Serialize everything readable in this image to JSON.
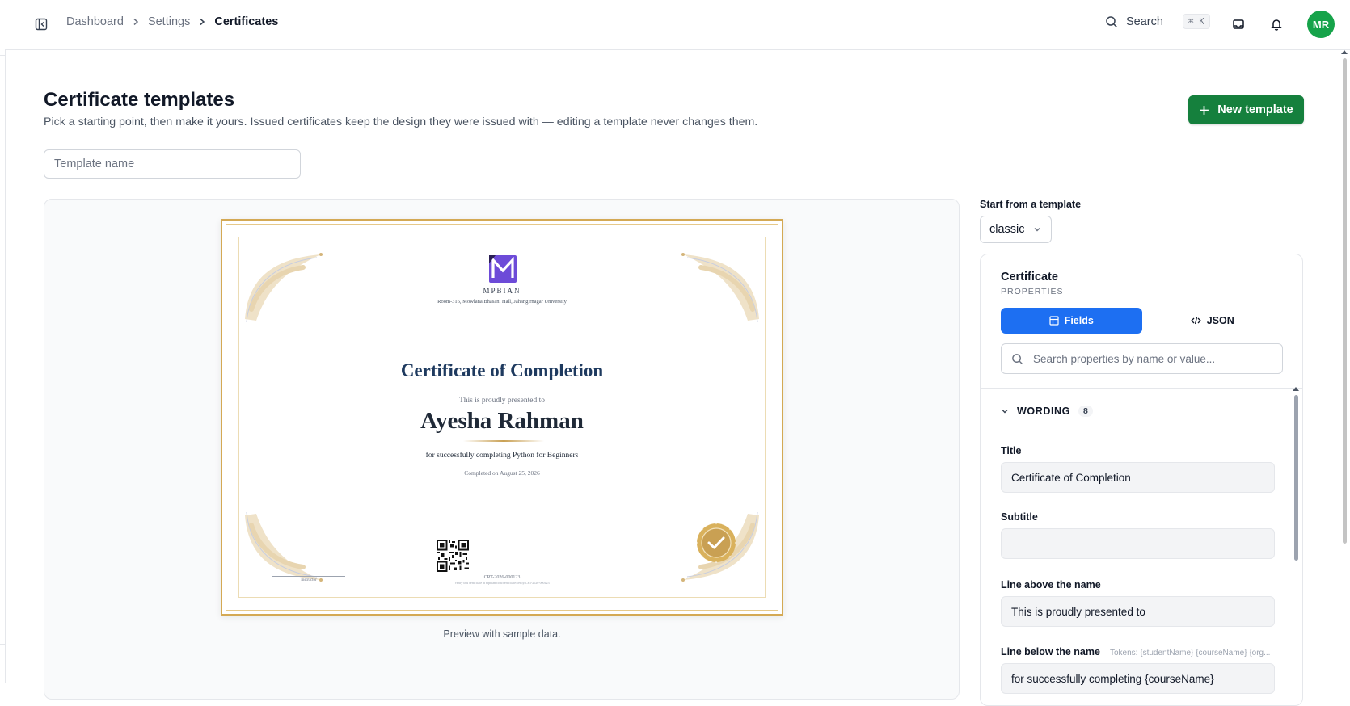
{
  "header": {
    "breadcrumb": [
      "Dashboard",
      "Settings",
      "Certificates"
    ],
    "search_label": "Search",
    "search_shortcut": "⌘ K",
    "avatar_initials": "MR"
  },
  "page": {
    "title": "Certificate templates",
    "subtitle": "Pick a starting point, then make it yours. Issued certificates keep the design they were issued with — editing a template never changes them.",
    "new_template_label": "New template",
    "template_name_placeholder": "Template name"
  },
  "certificate": {
    "org_name": "MPBIAN",
    "org_address": "Room-316, Mowlana Bhasani Hall, Jahangirnagar University",
    "title": "Certificate of Completion",
    "presented_line": "This is proudly presented to",
    "student_name": "Ayesha Rahman",
    "completion_line": "for successfully completing Python for Beginners",
    "completed_on": "Completed on August 25, 2026",
    "signature_label": "Instructor",
    "certificate_id": "CRT-2026-000123",
    "verify_line": "Verify this certificate at mpbian.com/certificate/verify/CRT-2026-000123",
    "brand_color": "#6d4bd8",
    "gold_color": "#c9a053"
  },
  "preview_caption": "Preview with sample data.",
  "sidebar": {
    "start_label": "Start from a template",
    "selected_template": "classic",
    "card_title": "Certificate",
    "card_subtitle": "PROPERTIES",
    "tab_fields": "Fields",
    "tab_json": "JSON",
    "search_placeholder": "Search properties by name or value...",
    "section_label": "WORDING",
    "section_count": "8",
    "fields": {
      "title_label": "Title",
      "title_value": "Certificate of Completion",
      "subtitle_label": "Subtitle",
      "subtitle_value": "",
      "above_label": "Line above the name",
      "above_value": "This is proudly presented to",
      "below_label": "Line below the name",
      "below_tokens": "Tokens: {studentName} {courseName} {org...",
      "below_value": "for successfully completing {courseName}"
    }
  },
  "colors": {
    "primary_green": "#15803d",
    "active_tab_blue": "#1d6ff2",
    "avatar_green": "#16a34a"
  }
}
